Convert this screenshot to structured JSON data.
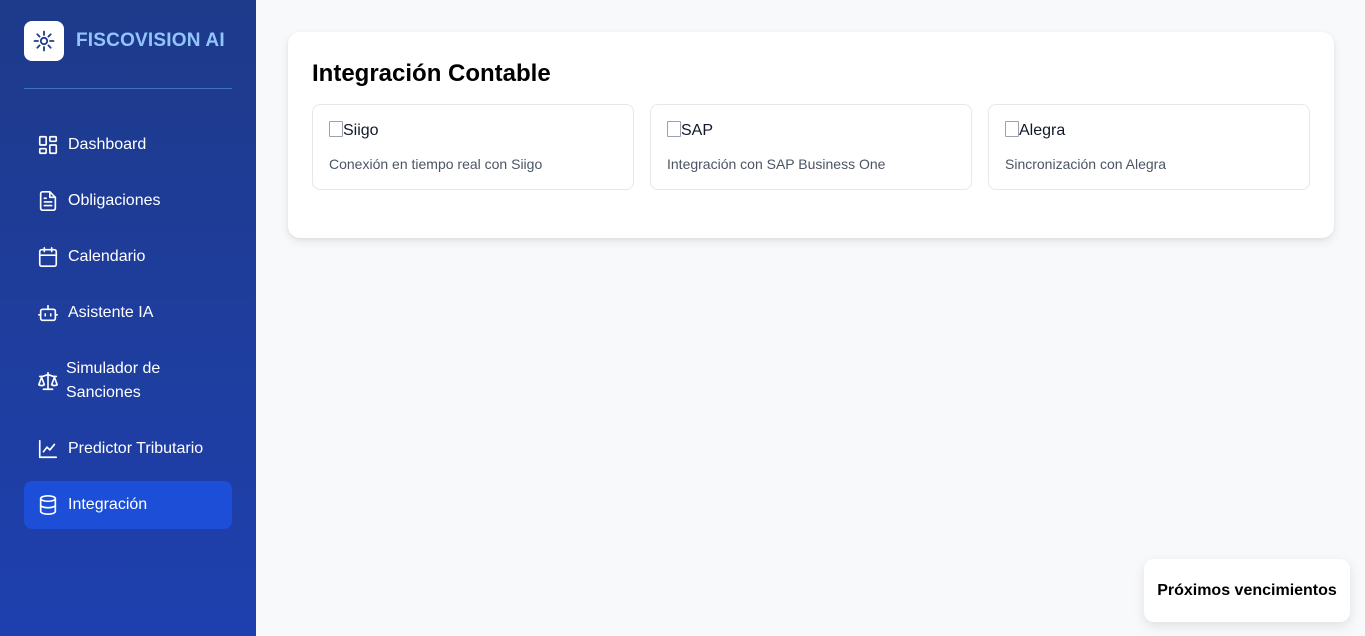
{
  "app": {
    "brand_name": "FISCOVISION AI",
    "logo_icon": "sun-burst-icon"
  },
  "sidebar": {
    "items": [
      {
        "label": "Dashboard",
        "icon": "dashboard-grid-icon",
        "active": false
      },
      {
        "label": "Obligaciones",
        "icon": "document-icon",
        "active": false
      },
      {
        "label": "Calendario",
        "icon": "calendar-icon",
        "active": false
      },
      {
        "label": "Asistente IA",
        "icon": "robot-icon",
        "active": false
      },
      {
        "label": "Simulador de",
        "label_line2": "Sanciones",
        "icon": "scale-icon",
        "active": false
      },
      {
        "label": "Predictor Tributario",
        "icon": "line-chart-icon",
        "active": false
      },
      {
        "label": "Integración",
        "icon": "database-icon",
        "active": true
      }
    ]
  },
  "main": {
    "title": "Integración Contable",
    "integrations": [
      {
        "alt": "Siigo",
        "description": "Conexión en tiempo real con Siigo"
      },
      {
        "alt": "SAP",
        "description": "Integración con SAP Business One"
      },
      {
        "alt": "Alegra",
        "description": "Sincronización con Alegra"
      }
    ]
  },
  "toast": {
    "label": "Próximos vencimientos"
  },
  "colors": {
    "sidebar_bg": "#1e40af",
    "active_item": "#1d4ed8",
    "brand_text": "#93c5fd",
    "page_bg": "#f8f9fb"
  }
}
